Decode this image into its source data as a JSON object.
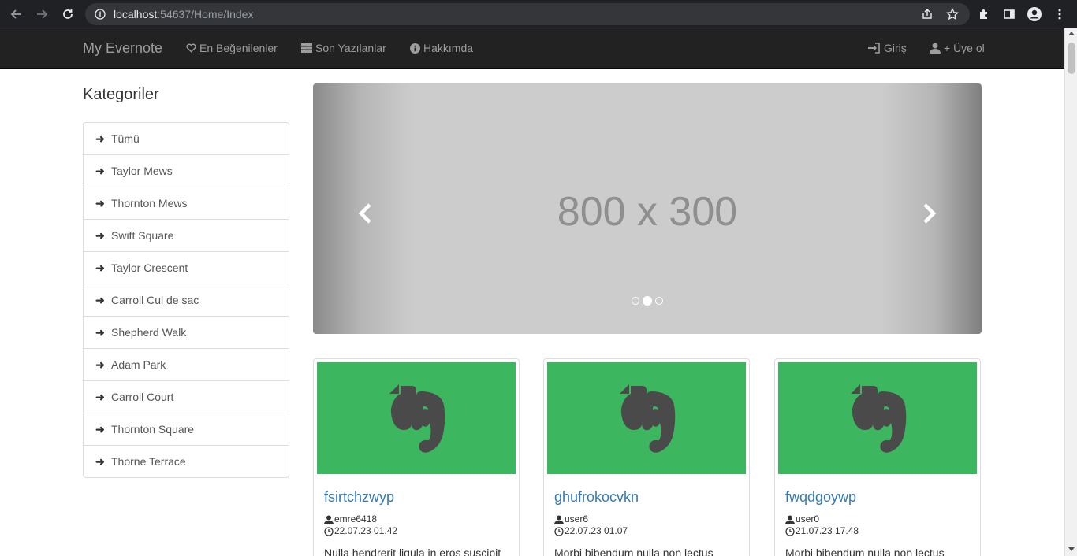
{
  "browser": {
    "url_host": "localhost",
    "url_rest": ":54637/Home/Index"
  },
  "navbar": {
    "brand": "My Evernote",
    "links": [
      {
        "label": "En Beğenilenler",
        "icon": "heart-icon"
      },
      {
        "label": "Son Yazılanlar",
        "icon": "list-icon"
      },
      {
        "label": "Hakkımda",
        "icon": "info-icon"
      }
    ],
    "right_links": [
      {
        "label": "Giriş",
        "icon": "log-in-icon"
      },
      {
        "label": "+ Üye ol",
        "icon": "user-icon"
      }
    ]
  },
  "sidebar": {
    "title": "Kategoriler",
    "items": [
      {
        "label": "Tümü"
      },
      {
        "label": "Taylor Mews"
      },
      {
        "label": "Thornton Mews"
      },
      {
        "label": "Swift Square"
      },
      {
        "label": "Taylor Crescent"
      },
      {
        "label": "Carroll Cul de sac"
      },
      {
        "label": "Shepherd Walk"
      },
      {
        "label": "Adam Park"
      },
      {
        "label": "Carroll Court"
      },
      {
        "label": "Thornton Square"
      },
      {
        "label": "Thorne Terrace"
      }
    ]
  },
  "carousel": {
    "placeholder": "800 x 300",
    "active_index": 1,
    "slide_count": 3
  },
  "notes": [
    {
      "title": "fsirtchzwyp",
      "user": "emre6418",
      "date": "22.07.23 01.42",
      "excerpt": "Nulla hendrerit ligula in eros suscipit"
    },
    {
      "title": "ghufrokocvkn",
      "user": "user6",
      "date": "22.07.23 01.07",
      "excerpt": "Morbi bibendum nulla non lectus"
    },
    {
      "title": "fwqdgoywp",
      "user": "user0",
      "date": "21.07.23 17.48",
      "excerpt": "Morbi bibendum nulla non lectus"
    }
  ],
  "colors": {
    "navbar_bg": "#222222",
    "note_image_bg": "#3db660",
    "link": "#337ab7"
  }
}
